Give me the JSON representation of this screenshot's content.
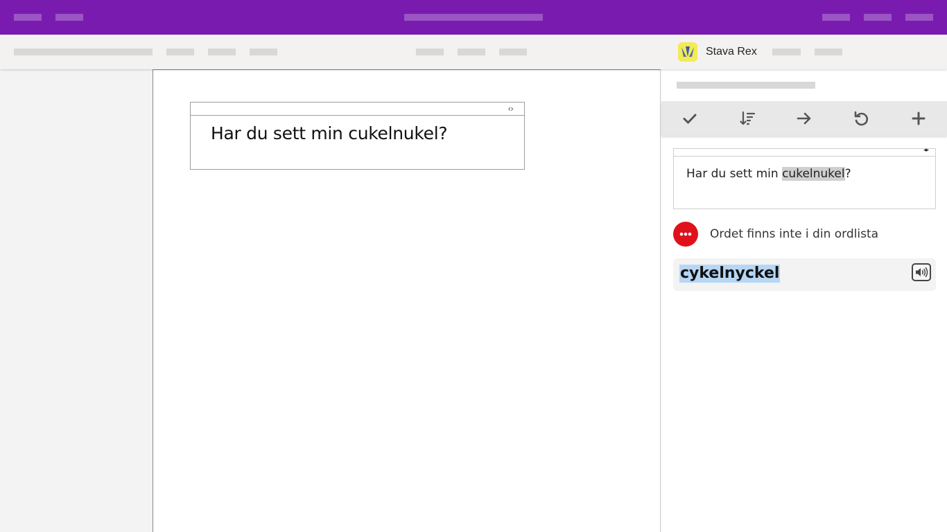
{
  "addin": {
    "name": "Stava Rex"
  },
  "document": {
    "text": "Har du sett min cukelnukel?",
    "box_toggle": "‹›"
  },
  "pane": {
    "box_toggle": "◂▸",
    "text_before": "Har du sett min ",
    "text_highlight": "cukelnukel",
    "text_after": "?",
    "status_text": "Ordet finns inte i din ordlista",
    "suggestion": "cykelnyckel",
    "toolbar": [
      "check-icon",
      "sort-icon",
      "arrow-right-icon",
      "undo-icon",
      "plus-icon"
    ]
  },
  "colors": {
    "titlebar": "#7a1bb0",
    "status_error": "#e0111b",
    "selection": "#b7d6f5"
  }
}
